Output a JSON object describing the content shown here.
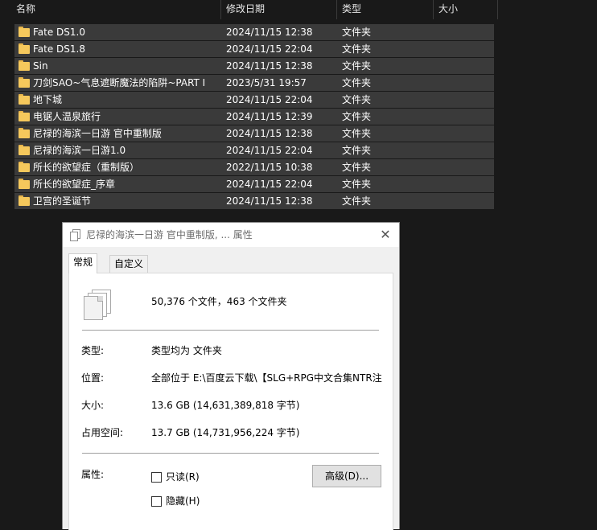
{
  "columns": {
    "name": "名称",
    "date": "修改日期",
    "type": "类型",
    "size": "大小"
  },
  "rows": [
    {
      "name": "Fate DS1.0",
      "date": "2024/11/15 12:38",
      "type": "文件夹"
    },
    {
      "name": "Fate DS1.8",
      "date": "2024/11/15 22:04",
      "type": "文件夹"
    },
    {
      "name": "Sin",
      "date": "2024/11/15 12:38",
      "type": "文件夹"
    },
    {
      "name": "刀剑SAO~气息遮断魔法的陷阱~PART I",
      "date": "2023/5/31 19:57",
      "type": "文件夹"
    },
    {
      "name": "地下城",
      "date": "2024/11/15 22:04",
      "type": "文件夹"
    },
    {
      "name": "电锯人温泉旅行",
      "date": "2024/11/15 12:39",
      "type": "文件夹"
    },
    {
      "name": "尼禄的海滨一日游 官中重制版",
      "date": "2024/11/15 12:38",
      "type": "文件夹"
    },
    {
      "name": "尼禄的海滨一日游1.0",
      "date": "2024/11/15 22:04",
      "type": "文件夹"
    },
    {
      "name": "所长的欲望症（重制版）",
      "date": "2022/11/15 10:38",
      "type": "文件夹"
    },
    {
      "name": "所长的欲望症_序章",
      "date": "2024/11/15 22:04",
      "type": "文件夹"
    },
    {
      "name": "卫宫的圣诞节",
      "date": "2024/11/15 12:38",
      "type": "文件夹"
    }
  ],
  "dialog": {
    "title": "尼禄的海滨一日游 官中重制版, ... 属性",
    "close_glyph": "✕",
    "tabs": {
      "general": "常规",
      "custom": "自定义"
    },
    "summary": "50,376 个文件，463 个文件夹",
    "type_label": "类型:",
    "type_value": "类型均为 文件夹",
    "location_label": "位置:",
    "location_value": "全部位于 E:\\百度云下载\\【SLG+RPG中文合集NTR注意】",
    "size_label": "大小:",
    "size_value": "13.6 GB (14,631,389,818 字节)",
    "disk_label": "占用空间:",
    "disk_value": "13.7 GB (14,731,956,224 字节)",
    "attr_label": "属性:",
    "readonly_label": "只读(R)",
    "hidden_label": "隐藏(H)",
    "advanced_button": "高级(D)..."
  },
  "colors": {
    "background": "#191919",
    "row_selected": "#3a3a3a",
    "folder": "#f5c85c",
    "dialog_bg": "#f0f0f0"
  },
  "icons": {
    "folder": "folder-icon",
    "files": "multiple-files-icon",
    "title": "properties-icon",
    "close": "close-icon"
  }
}
